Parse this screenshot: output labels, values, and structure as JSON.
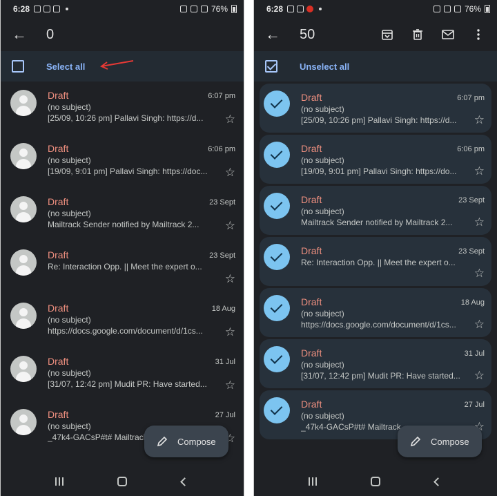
{
  "colors": {
    "accent": "#8ab4f8",
    "draft_red": "#ee8f7f",
    "check_blue": "#7cc4f0",
    "arrow_red": "#e53935"
  },
  "status_bar": {
    "time": "6:28",
    "battery": "76%"
  },
  "left": {
    "count": "0",
    "select_label": "Select all",
    "fab_label": "Compose",
    "emails": [
      {
        "sender": "Draft",
        "date": "6:07 pm",
        "subject": "(no subject)",
        "snippet": "[25/09, 10:26 pm] Pallavi Singh: https://d..."
      },
      {
        "sender": "Draft",
        "date": "6:06 pm",
        "subject": "(no subject)",
        "snippet": "[19/09, 9:01 pm] Pallavi Singh: https://doc..."
      },
      {
        "sender": "Draft",
        "date": "23 Sept",
        "subject": "(no subject)",
        "snippet": "Mailtrack Sender notified by Mailtrack 2..."
      },
      {
        "sender": "Draft",
        "date": "23 Sept",
        "subject": "",
        "snippet": "Re: Interaction Opp. || Meet the expert o..."
      },
      {
        "sender": "Draft",
        "date": "18 Aug",
        "subject": "(no subject)",
        "snippet": "https://docs.google.com/document/d/1cs..."
      },
      {
        "sender": "Draft",
        "date": "31 Jul",
        "subject": "(no subject)",
        "snippet": "[31/07, 12:42 pm] Mudit PR: Have started..."
      },
      {
        "sender": "Draft",
        "date": "27 Jul",
        "subject": "(no subject)",
        "snippet": "_47k4-GACsP#t# Mailtrack"
      }
    ]
  },
  "right": {
    "count": "50",
    "select_label": "Unselect all",
    "fab_label": "Compose",
    "actions": [
      "archive-icon",
      "delete-icon",
      "mail-icon",
      "more-vert-icon"
    ],
    "emails": [
      {
        "sender": "Draft",
        "date": "6:07 pm",
        "subject": "(no subject)",
        "snippet": "[25/09, 10:26 pm] Pallavi Singh: https://d..."
      },
      {
        "sender": "Draft",
        "date": "6:06 pm",
        "subject": "(no subject)",
        "snippet": "[19/09, 9:01 pm] Pallavi Singh: https://do..."
      },
      {
        "sender": "Draft",
        "date": "23 Sept",
        "subject": "(no subject)",
        "snippet": "Mailtrack Sender notified by Mailtrack 2..."
      },
      {
        "sender": "Draft",
        "date": "23 Sept",
        "subject": "",
        "snippet": "Re: Interaction Opp. || Meet the expert o..."
      },
      {
        "sender": "Draft",
        "date": "18 Aug",
        "subject": "(no subject)",
        "snippet": "https://docs.google.com/document/d/1cs..."
      },
      {
        "sender": "Draft",
        "date": "31 Jul",
        "subject": "(no subject)",
        "snippet": "[31/07, 12:42 pm] Mudit PR: Have started..."
      },
      {
        "sender": "Draft",
        "date": "27 Jul",
        "subject": "(no subject)",
        "snippet": "_47k4-GACsP#t# Mailtrack"
      }
    ]
  }
}
